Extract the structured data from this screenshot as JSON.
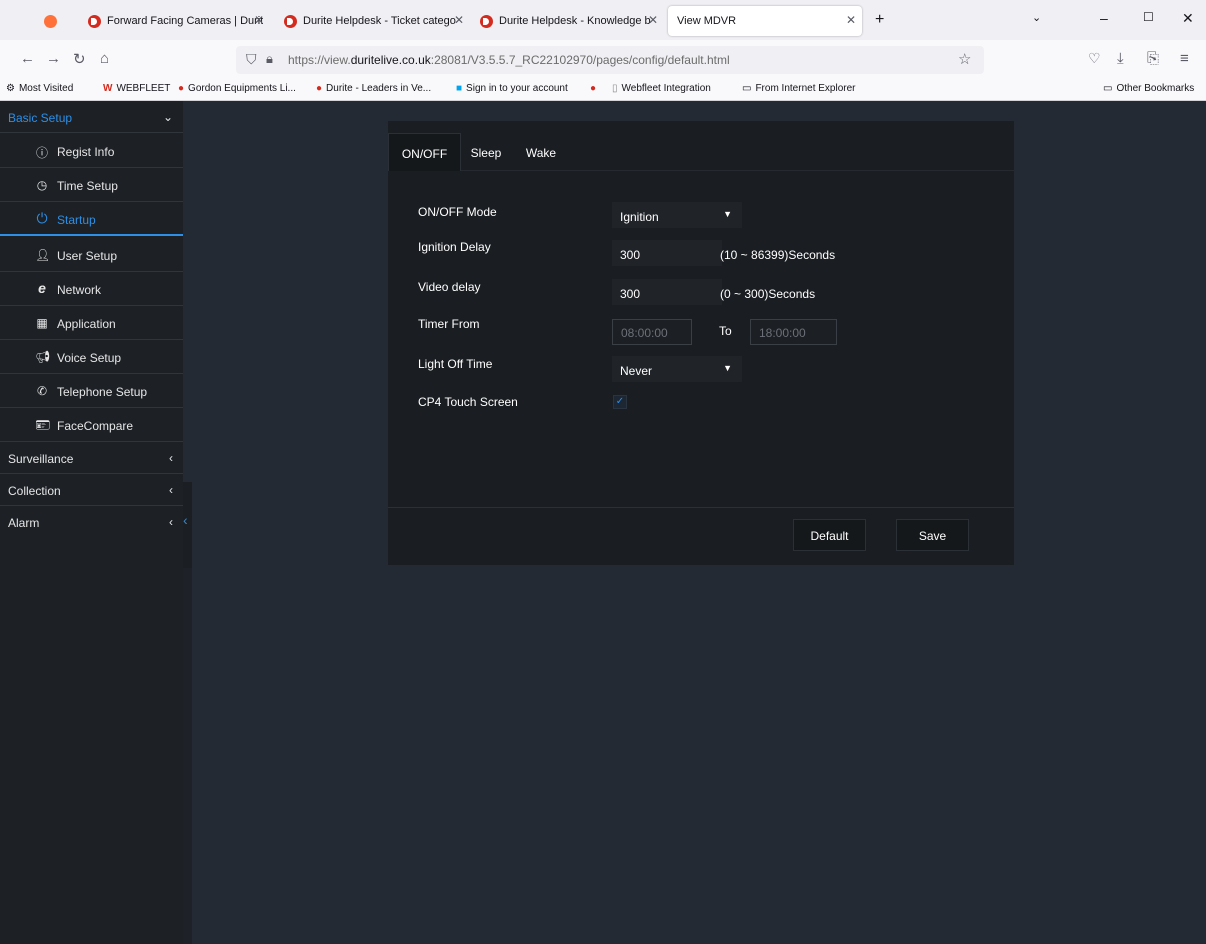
{
  "browser": {
    "tabs": [
      {
        "title": "Forward Facing Cameras | Durit"
      },
      {
        "title": "Durite Helpdesk - Ticket catego"
      },
      {
        "title": "Durite Helpdesk - Knowledge b"
      },
      {
        "title": "View MDVR"
      }
    ],
    "url": {
      "prefix": "https://view.",
      "domain": "duritelive.co.uk",
      "suffix": ":28081/V3.5.5.7_RC22102970/pages/config/default.html"
    },
    "bookmarks": [
      "Most Visited",
      "WEBFLEET",
      "Gordon Equipments Li...",
      "Durite - Leaders in Ve...",
      "Sign in to your account",
      "Webfleet Integration",
      "From Internet Explorer"
    ],
    "other_bookmarks": "Other Bookmarks"
  },
  "sidebar": {
    "basic_setup": "Basic Setup",
    "items": [
      {
        "label": "Regist Info",
        "icon": "info-icon"
      },
      {
        "label": "Time Setup",
        "icon": "clock-icon"
      },
      {
        "label": "Startup",
        "icon": "power-icon"
      },
      {
        "label": "User Setup",
        "icon": "user-icon"
      },
      {
        "label": "Network",
        "icon": "ie-icon"
      },
      {
        "label": "Application",
        "icon": "grid-icon"
      },
      {
        "label": "Voice Setup",
        "icon": "megaphone-icon"
      },
      {
        "label": "Telephone Setup",
        "icon": "phone-icon"
      },
      {
        "label": "FaceCompare",
        "icon": "id-card-icon"
      }
    ],
    "surveillance": "Surveillance",
    "collection": "Collection",
    "alarm": "Alarm",
    "accent_color": "#2d8fe6"
  },
  "panel": {
    "tabs": [
      "ON/OFF",
      "Sleep",
      "Wake"
    ],
    "labels": {
      "mode": "ON/OFF Mode",
      "ignition_delay": "Ignition Delay",
      "video_delay": "Video delay",
      "timer_from": "Timer From",
      "to": "To",
      "light_off": "Light Off Time",
      "cp4": "CP4 Touch Screen"
    },
    "values": {
      "mode": "Ignition",
      "ignition_delay": "300",
      "ignition_hint": "(10 ~ 86399)Seconds",
      "video_delay": "300",
      "video_hint": "(0 ~ 300)Seconds",
      "timer_from": "08:00:00",
      "timer_to": "18:00:00",
      "light_off": "Never"
    },
    "buttons": {
      "default": "Default",
      "save": "Save"
    }
  }
}
